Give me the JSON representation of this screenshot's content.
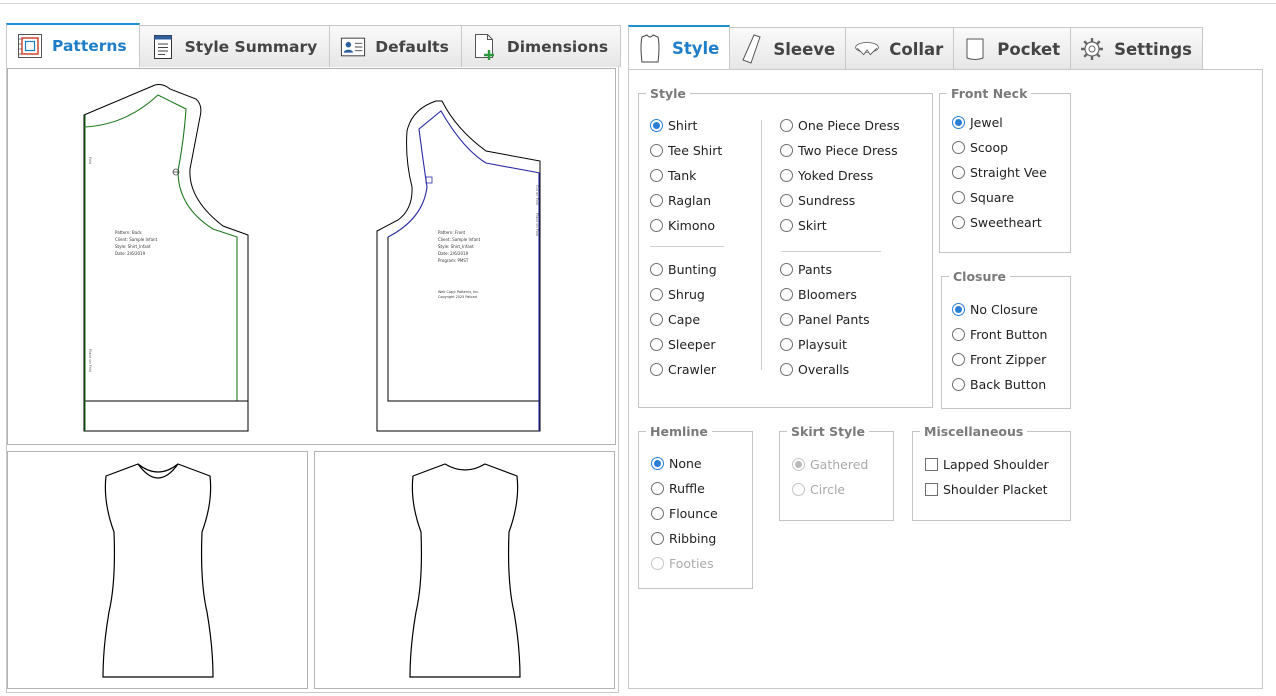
{
  "left_tabs": [
    {
      "label": "Patterns",
      "icon": "pattern-icon",
      "active": true
    },
    {
      "label": "Style Summary",
      "icon": "summary-document-icon",
      "active": false
    },
    {
      "label": "Defaults",
      "icon": "profile-card-icon",
      "active": false
    },
    {
      "label": "Dimensions",
      "icon": "add-document-icon",
      "active": false
    }
  ],
  "right_tabs": [
    {
      "label": "Style",
      "icon": "shirt-icon",
      "active": true
    },
    {
      "label": "Sleeve",
      "icon": "sleeve-icon",
      "active": false
    },
    {
      "label": "Collar",
      "icon": "collar-icon",
      "active": false
    },
    {
      "label": "Pocket",
      "icon": "pocket-icon",
      "active": false
    },
    {
      "label": "Settings",
      "icon": "gear-icon",
      "active": false
    }
  ],
  "patterns": {
    "back_piece": {
      "info": [
        "Pattern: Back",
        "Client: Sample Infant",
        "Style: Shirt_Infant",
        "Date: 2/6/2019"
      ],
      "fold_label_top": "Fold",
      "fold_label_bottom": "Place on Fold"
    },
    "front_piece": {
      "info": [
        "Pattern: Front",
        "Client: Sample Infant",
        "Style: Shirt_Infant",
        "Date: 2/6/2019",
        "Program: PMST"
      ],
      "copyright": [
        "Web Copy: Patterns, Inc.",
        "Copyright 2025 Patcad"
      ],
      "fold_label_top": "Cut on Fold",
      "fold_label_bottom": "Place on Fold"
    }
  },
  "style_group": {
    "legend": "Style",
    "col1": [
      "Shirt",
      "Tee Shirt",
      "Tank",
      "Raglan",
      "Kimono"
    ],
    "col1b": [
      "Bunting",
      "Shrug",
      "Cape",
      "Sleeper",
      "Crawler"
    ],
    "col2": [
      "One Piece Dress",
      "Two Piece Dress",
      "Yoked Dress",
      "Sundress",
      "Skirt"
    ],
    "col2b": [
      "Pants",
      "Bloomers",
      "Panel Pants",
      "Playsuit",
      "Overalls"
    ],
    "selected": "Shirt"
  },
  "front_neck": {
    "legend": "Front Neck",
    "options": [
      "Jewel",
      "Scoop",
      "Straight Vee",
      "Square",
      "Sweetheart"
    ],
    "selected": "Jewel"
  },
  "closure": {
    "legend": "Closure",
    "options": [
      "No Closure",
      "Front Button",
      "Front Zipper",
      "Back Button"
    ],
    "selected": "No Closure"
  },
  "hemline": {
    "legend": "Hemline",
    "options": [
      "None",
      "Ruffle",
      "Flounce",
      "Ribbing",
      "Footies"
    ],
    "selected": "None",
    "disabled": [
      "Footies"
    ]
  },
  "skirt_style": {
    "legend": "Skirt Style",
    "options": [
      "Gathered",
      "Circle"
    ],
    "selected": "Gathered",
    "disabled": true
  },
  "misc": {
    "legend": "Miscellaneous",
    "options": [
      "Lapped Shoulder",
      "Shoulder Placket"
    ],
    "checked": []
  },
  "colors": {
    "accent": "#1e90d0",
    "radio_selected": "#2a7fd4",
    "back_seam": "#1f7a1f",
    "front_seam": "#2b2ba8"
  }
}
